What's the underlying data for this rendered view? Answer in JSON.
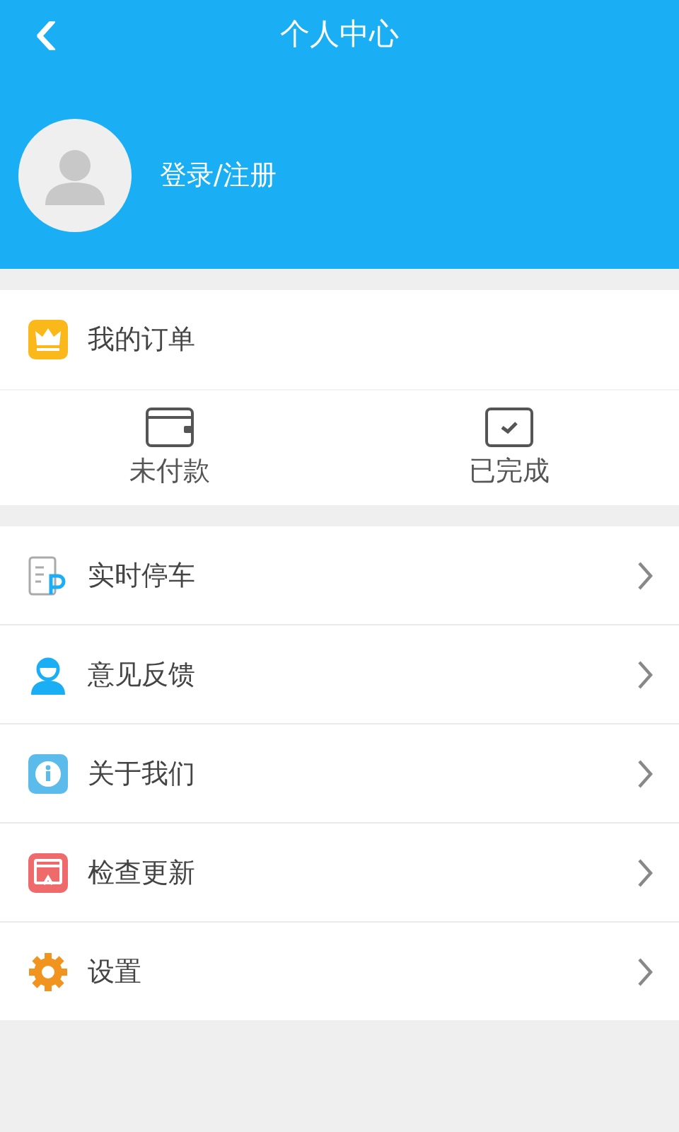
{
  "header": {
    "back": "‹",
    "title": "个人中心"
  },
  "profile": {
    "login": "登录/注册"
  },
  "orders": {
    "title": "我的订单",
    "tabs": [
      {
        "kind": "wallet",
        "label": "未付款"
      },
      {
        "kind": "done",
        "label": "已完成"
      }
    ]
  },
  "menu": [
    {
      "kind": "parking",
      "label": "实时停车"
    },
    {
      "kind": "feedback",
      "label": "意见反馈"
    },
    {
      "kind": "about",
      "label": "关于我们"
    },
    {
      "kind": "update",
      "label": "检查更新"
    },
    {
      "kind": "settings",
      "label": "设置"
    }
  ]
}
